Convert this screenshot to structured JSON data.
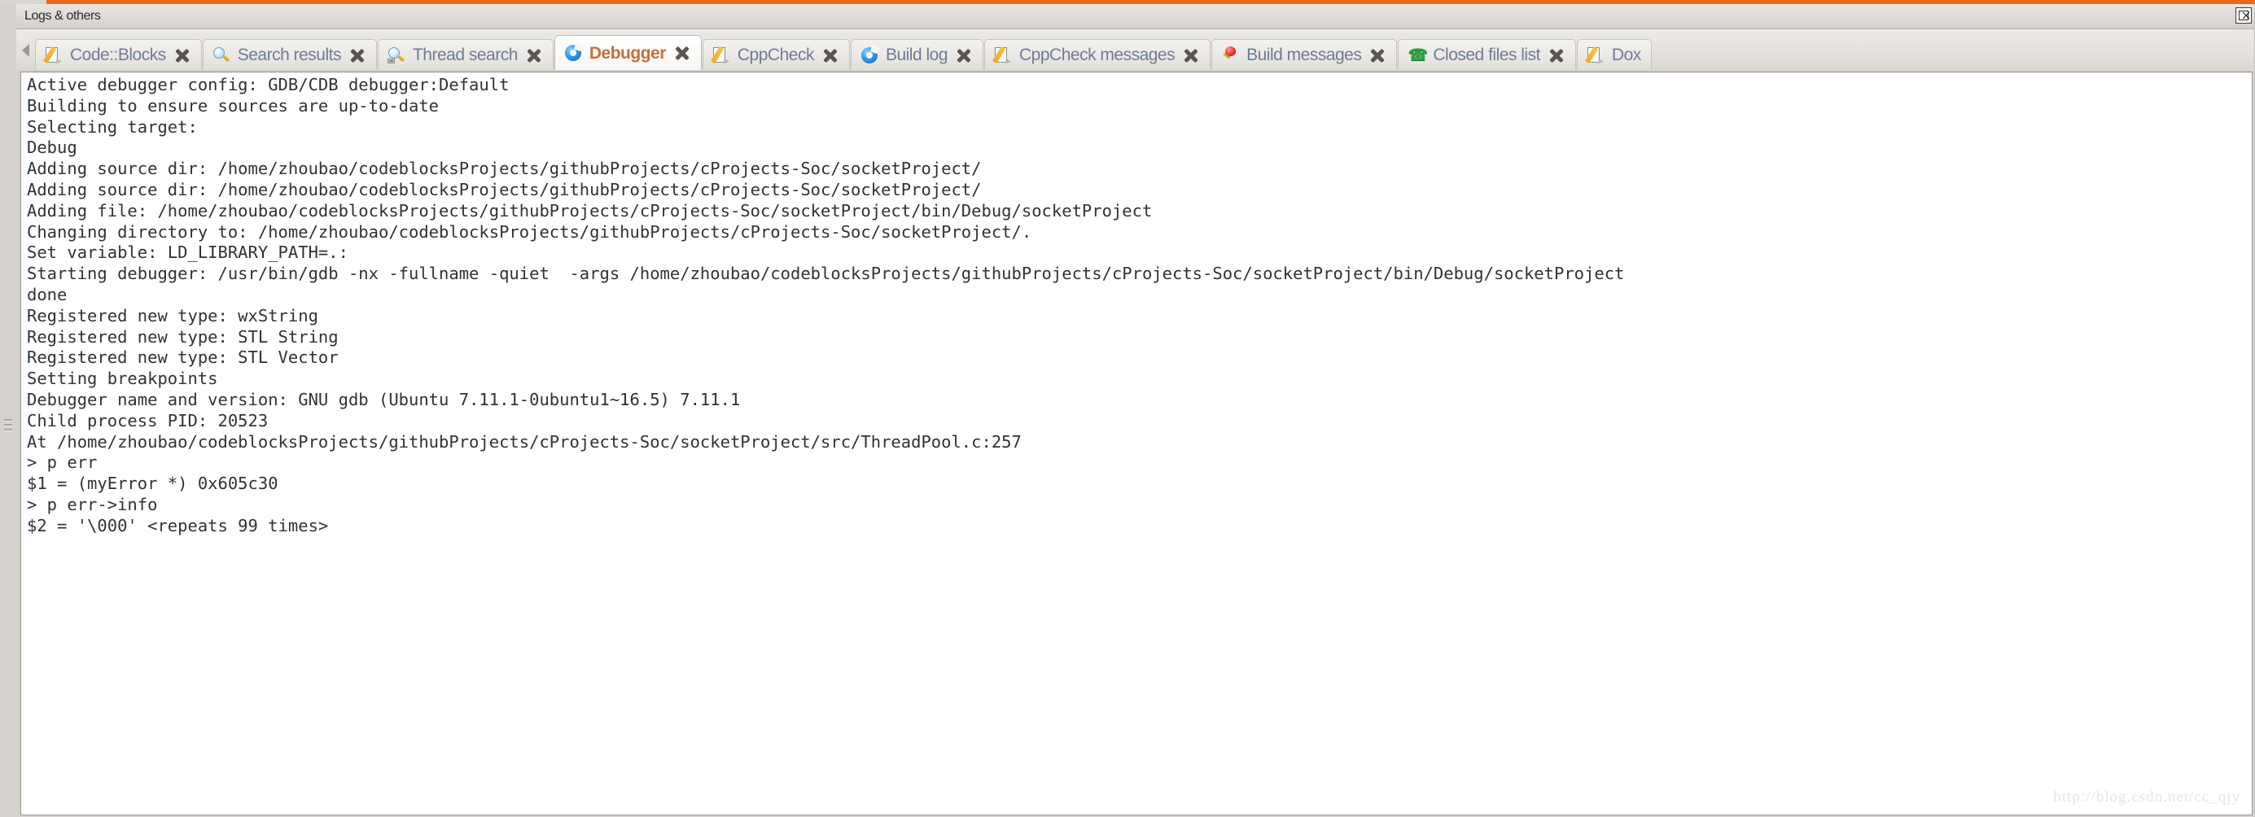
{
  "window": {
    "caption": "Logs & others",
    "caption_buttons": [
      {
        "name": "close-panel-button",
        "glyph": "☒"
      }
    ]
  },
  "tabstrip": {
    "scroll_left_arrow": "◀",
    "tabs": [
      {
        "label": "Code::Blocks",
        "icon": "notepad-pencil-icon",
        "active": false,
        "close_label": "✖"
      },
      {
        "label": "Search results",
        "icon": "magnifier-icon",
        "active": false,
        "close_label": "✖"
      },
      {
        "label": "Thread search",
        "icon": "magnifier-base-icon",
        "active": false,
        "close_label": "✖"
      },
      {
        "label": "Debugger",
        "icon": "blue-gear-icon",
        "active": true,
        "close_label": "✖"
      },
      {
        "label": "CppCheck",
        "icon": "notepad-pencil-icon",
        "active": false,
        "close_label": "✖"
      },
      {
        "label": "Build log",
        "icon": "blue-gear-icon",
        "active": false,
        "close_label": "✖"
      },
      {
        "label": "CppCheck messages",
        "icon": "notepad-pencil-icon",
        "active": false,
        "close_label": "✖"
      },
      {
        "label": "Build messages",
        "icon": "red-pin-icon",
        "active": false,
        "close_label": "✖"
      },
      {
        "label": "Closed files list",
        "icon": "green-phone-icon",
        "active": false,
        "close_label": "✖"
      },
      {
        "label": "Dox",
        "icon": "notepad-pencil-icon",
        "active": false,
        "close_label": ""
      }
    ]
  },
  "debugger_log": {
    "lines": [
      "Active debugger config: GDB/CDB debugger:Default",
      "Building to ensure sources are up-to-date",
      "Selecting target:",
      "Debug",
      "Adding source dir: /home/zhoubao/codeblocksProjects/githubProjects/cProjects-Soc/socketProject/",
      "Adding source dir: /home/zhoubao/codeblocksProjects/githubProjects/cProjects-Soc/socketProject/",
      "Adding file: /home/zhoubao/codeblocksProjects/githubProjects/cProjects-Soc/socketProject/bin/Debug/socketProject",
      "Changing directory to: /home/zhoubao/codeblocksProjects/githubProjects/cProjects-Soc/socketProject/.",
      "Set variable: LD_LIBRARY_PATH=.:",
      "Starting debugger: /usr/bin/gdb -nx -fullname -quiet  -args /home/zhoubao/codeblocksProjects/githubProjects/cProjects-Soc/socketProject/bin/Debug/socketProject",
      "done",
      "Registered new type: wxString",
      "Registered new type: STL String",
      "Registered new type: STL Vector",
      "Setting breakpoints",
      "Debugger name and version: GNU gdb (Ubuntu 7.11.1-0ubuntu1~16.5) 7.11.1",
      "Child process PID: 20523",
      "At /home/zhoubao/codeblocksProjects/githubProjects/cProjects-Soc/socketProject/src/ThreadPool.c:257",
      "> p err",
      "$1 = (myError *) 0x605c30",
      "> p err->info",
      "$2 = '\\000' <repeats 99 times>"
    ]
  },
  "watermark": {
    "text": "http://blog.csdn.net/cc_qjy"
  },
  "colors": {
    "accent_orange": "#e8681f",
    "tab_text": "#6f7c96",
    "active_tab_text": "#c4703a",
    "panel_bg": "#d6d2cd",
    "log_bg": "#ffffff",
    "log_text": "#2e3338"
  }
}
